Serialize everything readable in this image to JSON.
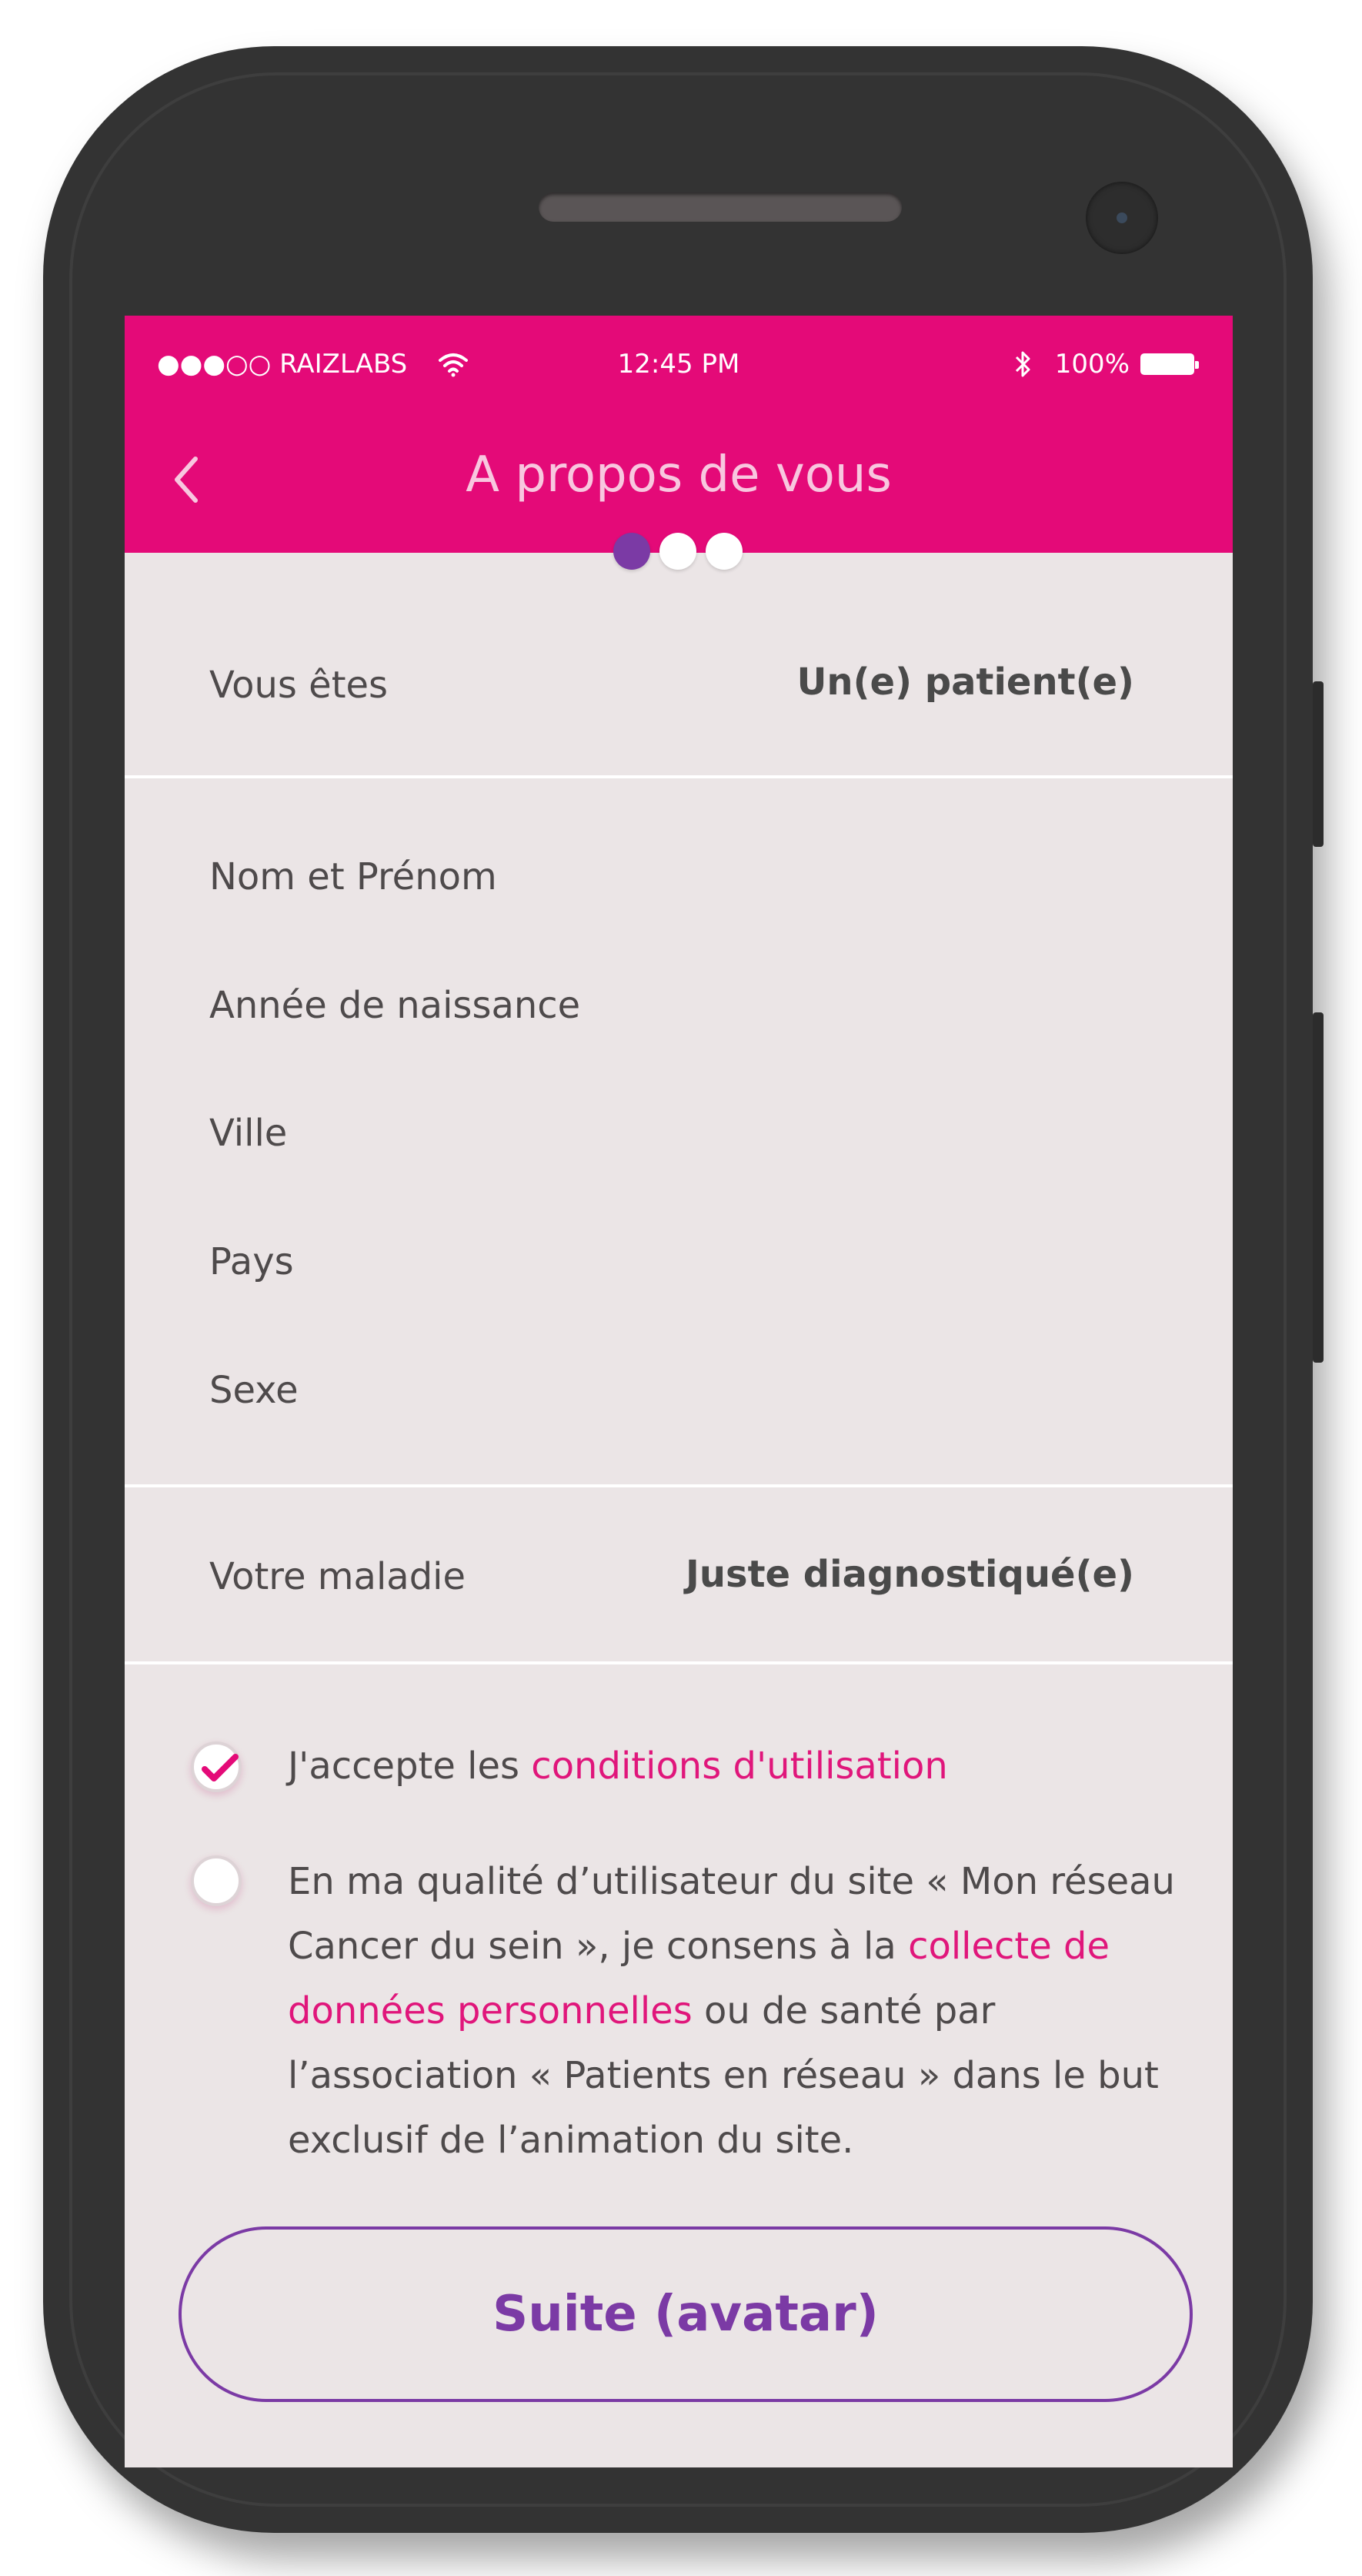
{
  "colors": {
    "brand": "#e40a78",
    "accent": "#7b3aa5",
    "background": "#ebe5e6",
    "link": "#e0167b"
  },
  "status_bar": {
    "carrier": "●●●○○ RAIZLABS",
    "time": "12:45 PM",
    "battery": "100%",
    "icons": [
      "wifi-icon",
      "bluetooth-icon",
      "battery-icon"
    ]
  },
  "header": {
    "title": "A propos de vous",
    "back_icon": "chevron-left-icon"
  },
  "progress": {
    "steps": 3,
    "current": 1
  },
  "profile": {
    "label": "Vous êtes",
    "value": "Un(e) patient(e)"
  },
  "fields": [
    {
      "label": "Nom et Prénom"
    },
    {
      "label": "Année de naissance"
    },
    {
      "label": "Ville"
    },
    {
      "label": "Pays"
    },
    {
      "label": "Sexe"
    }
  ],
  "disease": {
    "label": "Votre maladie",
    "value": "Juste diagnostiqué(e)"
  },
  "consents": [
    {
      "checked": true,
      "text_before": "J'accepte les ",
      "link": "conditions d'utilisation",
      "text_after": ""
    },
    {
      "checked": false,
      "text_before": "En ma qualité d’utilisateur du site « Mon réseau Cancer du sein », je consens à la ",
      "link": "collecte de données personnelles",
      "text_after": " ou de santé par l’association « Patients en réseau » dans le but exclusif de l’animation du site."
    }
  ],
  "cta": {
    "label": "Suite (avatar)"
  }
}
